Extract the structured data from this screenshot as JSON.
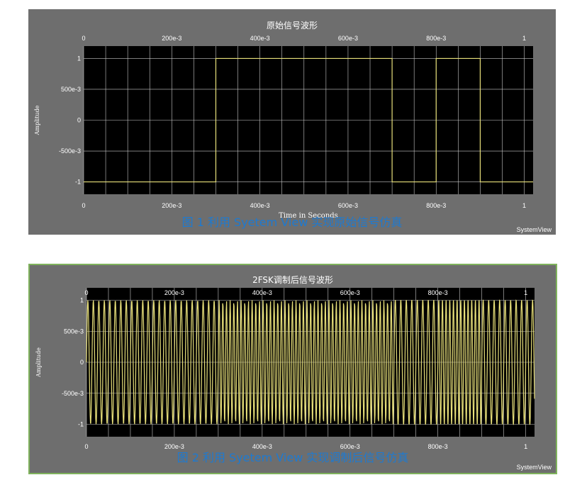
{
  "chart_data": [
    {
      "type": "line",
      "title": "原始信号波形",
      "xlabel": "Time in Seconds",
      "ylabel": "Amplitude",
      "xlim": [
        0,
        1.02
      ],
      "ylim": [
        -1.2,
        1.2
      ],
      "x_ticks": [
        "0",
        "200e-3",
        "400e-3",
        "600e-3",
        "800e-3",
        "1"
      ],
      "y_ticks": [
        "1",
        "500e-3",
        "0",
        "-500e-3",
        "-1"
      ],
      "grid": true,
      "background": "#000000",
      "line_color": "#e8e07a",
      "series": [
        {
          "x": [
            0,
            0.3,
            0.3,
            0.7,
            0.7,
            0.8,
            0.8,
            0.9,
            0.9,
            1.02
          ],
          "y": [
            -1,
            -1,
            1,
            1,
            -1,
            -1,
            1,
            1,
            -1,
            -1
          ]
        }
      ]
    },
    {
      "type": "line",
      "title": "2FSK调制后信号波形",
      "xlabel": "",
      "ylabel": "Amplitude",
      "xlim": [
        0,
        1.02
      ],
      "ylim": [
        -1.2,
        1.2
      ],
      "x_ticks": [
        "0",
        "200e-3",
        "400e-3",
        "600e-3",
        "800e-3",
        "1"
      ],
      "y_ticks": [
        "1",
        "500e-3",
        "0",
        "-500e-3",
        "-1"
      ],
      "grid": true,
      "background": "#000000",
      "line_color": "#e8e07a",
      "series": [
        {
          "segments": [
            {
              "x_start": 0,
              "x_end": 0.3,
              "freq": 80
            },
            {
              "x_start": 0.3,
              "x_end": 0.7,
              "freq": 120
            },
            {
              "x_start": 0.7,
              "x_end": 0.8,
              "freq": 80
            },
            {
              "x_start": 0.8,
              "x_end": 0.9,
              "freq": 120
            },
            {
              "x_start": 0.9,
              "x_end": 1.02,
              "freq": 80
            }
          ]
        }
      ]
    }
  ],
  "captions": {
    "fig1": "图 1 利用 Syetem View 实现原始信号仿真",
    "fig2": "图 2 利用 Syetem View 实现调制后信号仿真"
  },
  "brand": "SystemView"
}
